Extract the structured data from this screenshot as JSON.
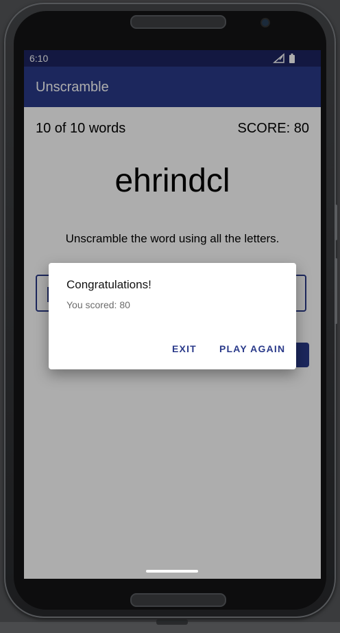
{
  "status_bar": {
    "time": "6:10"
  },
  "app_bar": {
    "title": "Unscramble"
  },
  "game": {
    "word_count": "10 of 10 words",
    "score": "SCORE: 80",
    "scrambled_word": "ehrindcl",
    "instructions": "Unscramble the word using all the letters."
  },
  "dialog": {
    "title": "Congratulations!",
    "message": "You scored: 80",
    "exit_label": "EXIT",
    "play_again_label": "PLAY AGAIN"
  },
  "colors": {
    "status_bar": "#1c2461",
    "primary": "#2a3a8a",
    "scrim": "rgba(0,0,0,0.32)"
  },
  "icons": [
    "signal-icon",
    "battery-icon"
  ]
}
